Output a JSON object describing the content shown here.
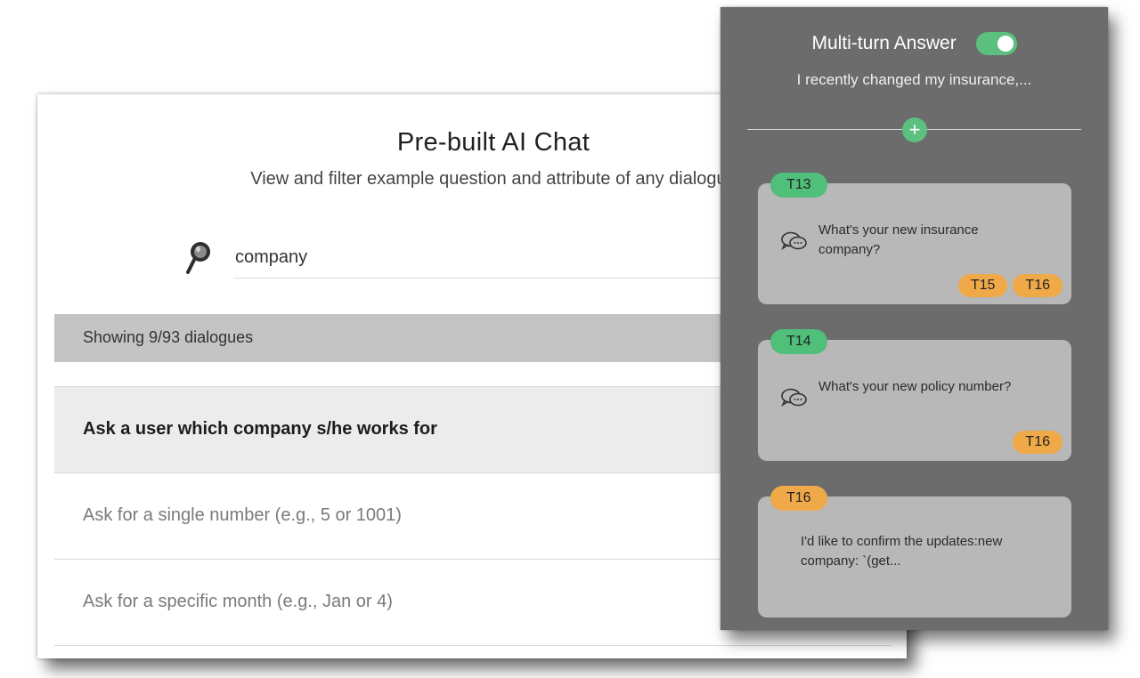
{
  "page": {
    "title": "Pre-built AI Chat",
    "subtitle": "View and filter example question and attribute of any dialogue"
  },
  "search": {
    "value": "company",
    "icon": "search-icon"
  },
  "results": {
    "text": "Showing 9/93 dialogues"
  },
  "dialogues": [
    {
      "label": "Ask a user which company s/he works for",
      "selected": true
    },
    {
      "label": "Ask for a single number (e.g., 5 or 1001)",
      "selected": false
    },
    {
      "label": "Ask for a specific month (e.g., Jan or 4)",
      "selected": false
    }
  ],
  "panel": {
    "title": "Multi-turn Answer",
    "toggle_on": true,
    "subtitle": "I recently changed my insurance,...",
    "add_icon": "+",
    "turns": [
      {
        "tag": "T13",
        "tag_color": "green",
        "text": "What's your new insurance company?",
        "next": [
          "T15",
          "T16"
        ]
      },
      {
        "tag": "T14",
        "tag_color": "green",
        "text": "What's your new policy number?",
        "next": [
          "T16"
        ]
      },
      {
        "tag": "T16",
        "tag_color": "orange",
        "text": "I'd like to confirm the updates:new company: `(get...",
        "next": []
      }
    ]
  },
  "colors": {
    "panel_bg": "#6c6c6c",
    "accent_green": "#5cc07f",
    "accent_orange": "#efa948",
    "results_bar": "#c4c4c4"
  }
}
